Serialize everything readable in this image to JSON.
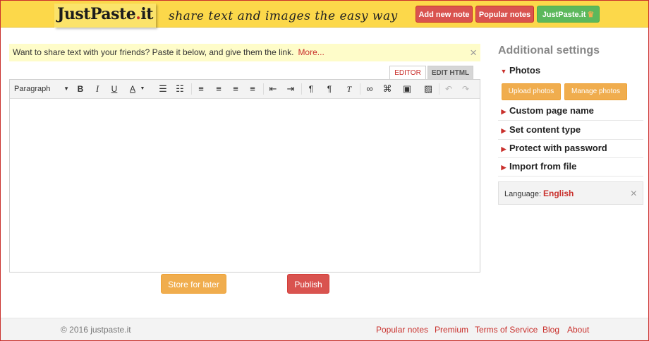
{
  "header": {
    "logo_main": "JustPaste",
    "logo_dot": ".",
    "logo_tld": "it",
    "tagline": "share text and images the easy way",
    "buttons": {
      "add_new_note": "Add new note",
      "popular_notes": "Popular notes",
      "justpaste_it": "JustPaste.it"
    },
    "colors": {
      "header_bg": "#fcd84a",
      "red": "#d9534f",
      "green": "#5cb85c"
    }
  },
  "infobar": {
    "text": "Want to share text with your friends? Paste it below, and give them the link.",
    "more": "More...",
    "close": "×"
  },
  "editor": {
    "tabs": {
      "editor": "EDITOR",
      "edit_html": "EDIT HTML"
    },
    "format_select": "Paragraph",
    "content": ""
  },
  "actions": {
    "store_for_later": "Store for later",
    "publish": "Publish"
  },
  "sidebar": {
    "title": "Additional settings",
    "sections": {
      "photos": "Photos",
      "custom_page_name": "Custom page name",
      "set_content_type": "Set content type",
      "protect_with_password": "Protect with password",
      "import_from_file": "Import from file"
    },
    "photo_buttons": {
      "upload": "Upload photos",
      "manage": "Manage photos"
    },
    "language": {
      "label": "Language:",
      "value": "English",
      "close": "×"
    }
  },
  "footer": {
    "copyright": "© 2016 justpaste.it",
    "links": {
      "popular_notes": "Popular notes",
      "premium": "Premium",
      "terms": "Terms of Service",
      "blog": "Blog",
      "about": "About"
    }
  }
}
